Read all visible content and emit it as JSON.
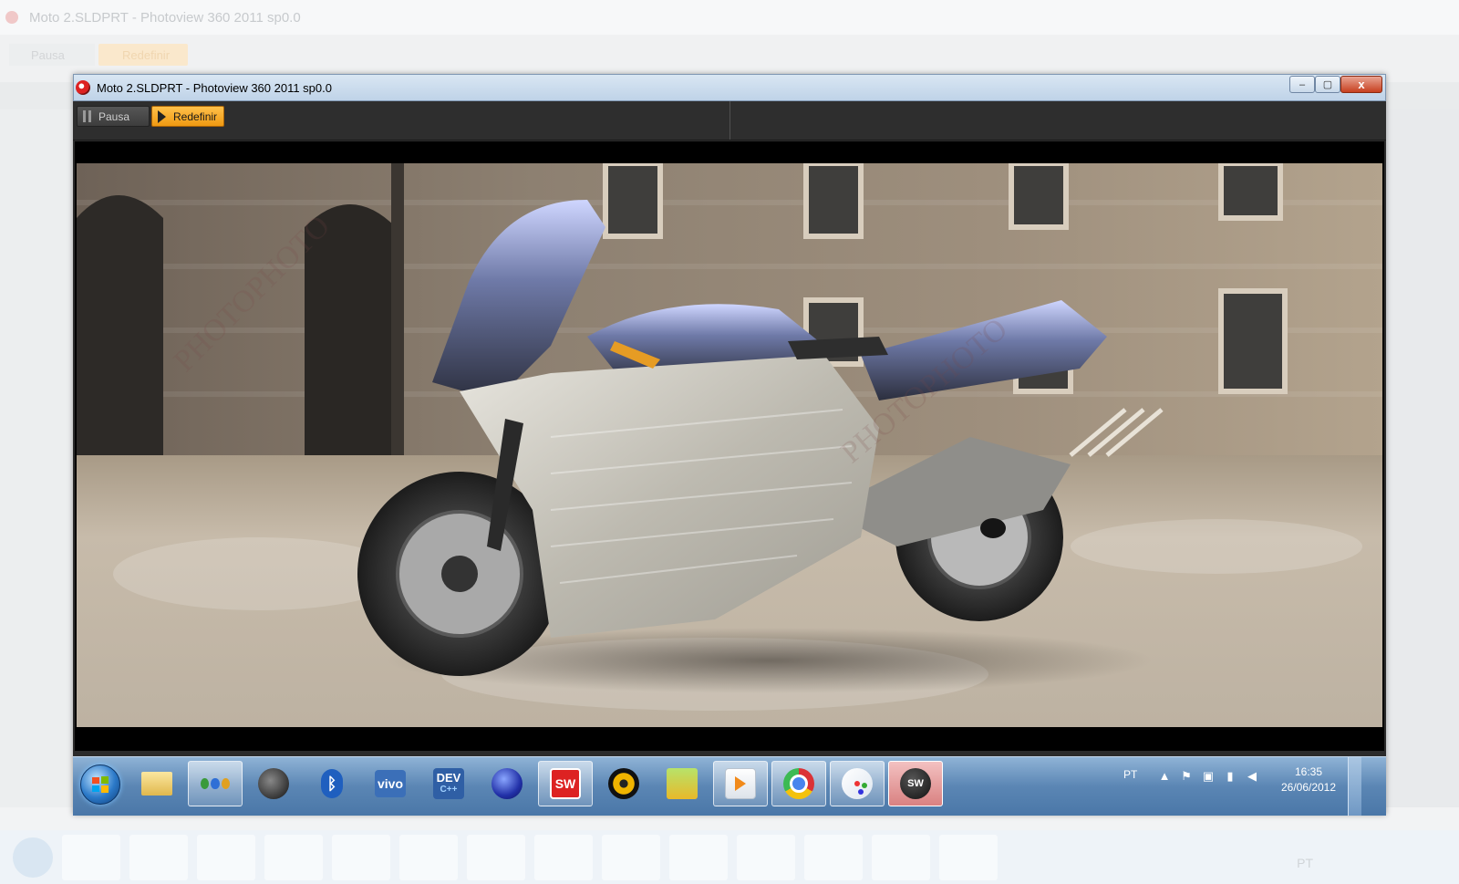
{
  "background": {
    "title": "Moto 2.SLDPRT - Photoview 360 2011 sp0.0",
    "pausa_label": "Pausa",
    "redefinir_label": "Redefinir",
    "tray_lang": "PT"
  },
  "window": {
    "title": "Moto 2.SLDPRT - Photoview 360 2011 sp0.0",
    "controls": {
      "minimize": "–",
      "maximize": "▢",
      "close": "x"
    }
  },
  "toolbar": {
    "pausa_label": "Pausa",
    "redefinir_label": "Redefinir"
  },
  "render": {
    "subject": "motorcycle",
    "watermark": "PHOTOPHOTO"
  },
  "taskbar": {
    "items": [
      {
        "icon": "folder-icon"
      },
      {
        "icon": "people-icon"
      },
      {
        "icon": "security-agent-icon"
      },
      {
        "icon": "bluetooth-icon",
        "text": "ᛒ"
      },
      {
        "icon": "vivo-icon",
        "text": "vivo"
      },
      {
        "icon": "dev-cpp-icon",
        "text": "DEV",
        "subtext": "C++"
      },
      {
        "icon": "eclipse-icon"
      },
      {
        "icon": "solidworks-icon",
        "text": "SW"
      },
      {
        "icon": "media-disc-icon"
      },
      {
        "icon": "pineapple-icon"
      },
      {
        "icon": "media-player-icon"
      },
      {
        "icon": "chrome-icon"
      },
      {
        "icon": "paint-icon"
      },
      {
        "icon": "photoview-icon",
        "text": "SW"
      }
    ],
    "tray": {
      "language": "PT",
      "time": "16:35",
      "date": "26/06/2012"
    }
  },
  "colors": {
    "accent_orange": "#f2a11f",
    "taskbar_blue": "#5b86b4",
    "toolbar_dark": "#2e2e2e"
  }
}
